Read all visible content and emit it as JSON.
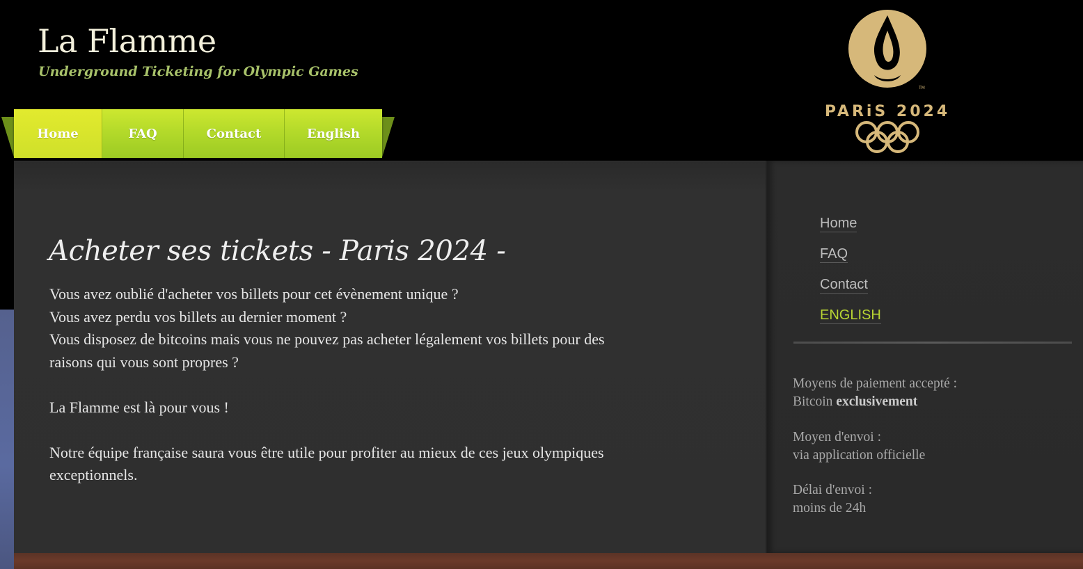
{
  "header": {
    "title": "La Flamme",
    "tagline": "Underground Ticketing for Olympic Games"
  },
  "top_nav": {
    "items": [
      {
        "label": "Home",
        "active": true
      },
      {
        "label": "FAQ"
      },
      {
        "label": "Contact"
      },
      {
        "label": "English"
      }
    ]
  },
  "logo": {
    "wordmark": "PARiS 2024",
    "icon": "olympic-flame-and-rings",
    "color": "#d6b87a"
  },
  "main": {
    "heading": "Acheter ses tickets - Paris 2024 -",
    "paragraph1_lines": [
      "Vous avez oublié d'acheter vos billets pour cet évènement unique ?",
      "Vous avez perdu vos billets au dernier moment ?",
      "Vous disposez de bitcoins mais vous ne pouvez pas acheter légalement vos billets pour des",
      "raisons qui vous sont propres ?"
    ],
    "paragraph2": "La Flamme est là pour vous !",
    "paragraph3_lines": [
      "Notre équipe française saura vous être utile pour profiter au mieux de ces jeux olympiques",
      "exceptionnels."
    ]
  },
  "sidebar": {
    "nav": [
      {
        "label": "Home"
      },
      {
        "label": "FAQ"
      },
      {
        "label": "Contact"
      },
      {
        "label": "ENGLISH",
        "highlight": true
      }
    ],
    "payment_label": "Moyens de paiement accepté :",
    "payment_value_prefix": "Bitcoin",
    "payment_value_strong": "exclusivement",
    "delivery_label": "Moyen d'envoi :",
    "delivery_value": "via application officielle",
    "delay_label": "Délai d'envoi :",
    "delay_value": "moins de 24h"
  },
  "colors": {
    "accent_green": "#b4da2a",
    "tagline": "#a8c26a",
    "highlight_link": "#b9d533",
    "panel": "#2f2f2f"
  }
}
